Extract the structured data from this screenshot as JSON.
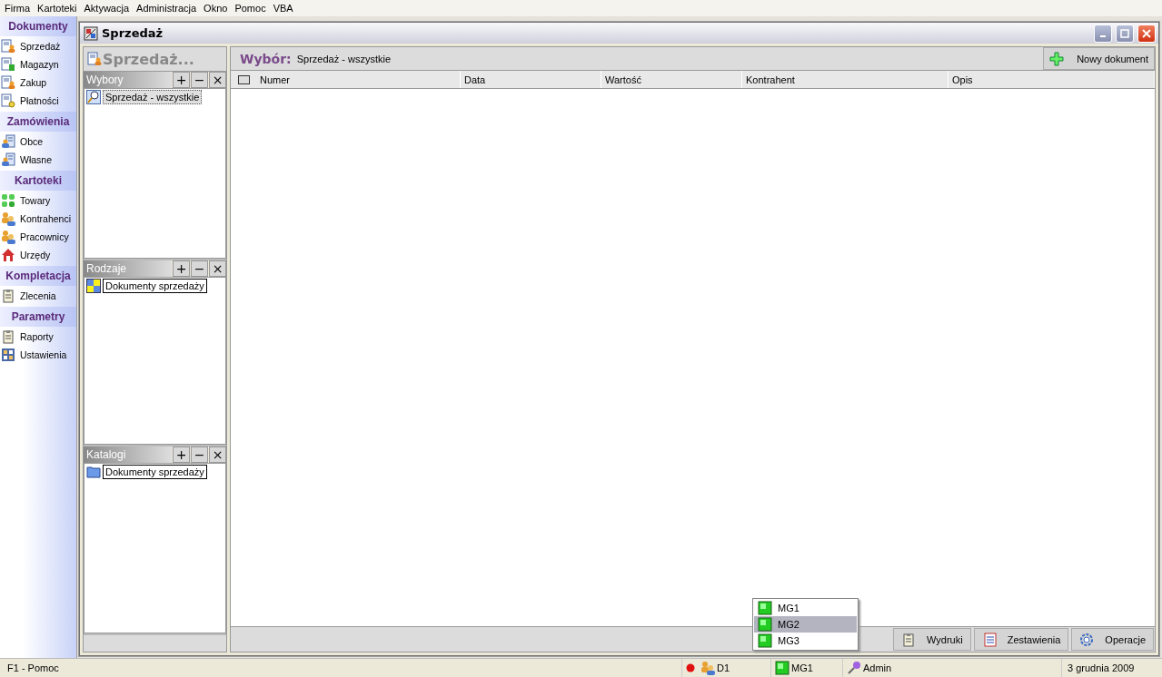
{
  "menu": [
    "Firma",
    "Kartoteki",
    "Aktywacja",
    "Administracja",
    "Okno",
    "Pomoc",
    "VBA"
  ],
  "nav": [
    {
      "title": "Dokumenty",
      "items": [
        "Sprzedaż",
        "Magazyn",
        "Zakup",
        "Płatności"
      ]
    },
    {
      "title": "Zamówienia",
      "items": [
        "Obce",
        "Własne"
      ]
    },
    {
      "title": "Kartoteki",
      "items": [
        "Towary",
        "Kontrahenci",
        "Pracownicy",
        "Urzędy"
      ]
    },
    {
      "title": "Kompletacja",
      "items": [
        "Zlecenia"
      ]
    },
    {
      "title": "Parametry",
      "items": [
        "Raporty",
        "Ustawienia"
      ]
    }
  ],
  "window": {
    "title": "Sprzedaż"
  },
  "left_panel": {
    "title": "Sprzedaż...",
    "panes": [
      {
        "title": "Wybory",
        "buttons": [
          "+",
          "−",
          "×"
        ],
        "items": [
          {
            "label": "Sprzedaż - wszystkie",
            "selected": true
          }
        ]
      },
      {
        "title": "Rodzaje",
        "buttons": [
          "+",
          "−",
          "×"
        ],
        "items": [
          {
            "label": "Dokumenty sprzedaży",
            "selected": false
          }
        ]
      },
      {
        "title": "Katalogi",
        "buttons": [
          "+",
          "−",
          "×"
        ],
        "items": [
          {
            "label": "Dokumenty sprzedaży",
            "selected": false
          }
        ]
      }
    ]
  },
  "selection": {
    "label": "Wybór:",
    "value": "Sprzedaż - wszystkie"
  },
  "new_button": "Nowy dokument",
  "table": {
    "select_all": {
      "checked": false
    },
    "columns": [
      "Numer",
      "Data",
      "Wartość",
      "Kontrahent",
      "Opis"
    ]
  },
  "bottom_buttons": [
    "Wydruki",
    "Zestawienia",
    "Operacje"
  ],
  "popup": [
    {
      "label": "MG1",
      "selected": false
    },
    {
      "label": "MG2",
      "selected": true
    },
    {
      "label": "MG3",
      "selected": false
    }
  ],
  "status_bar": {
    "help": "F1 - Pomoc",
    "database": "D1",
    "warehouse": "MG1",
    "user": "Admin",
    "date": "3 grudnia 2009"
  }
}
